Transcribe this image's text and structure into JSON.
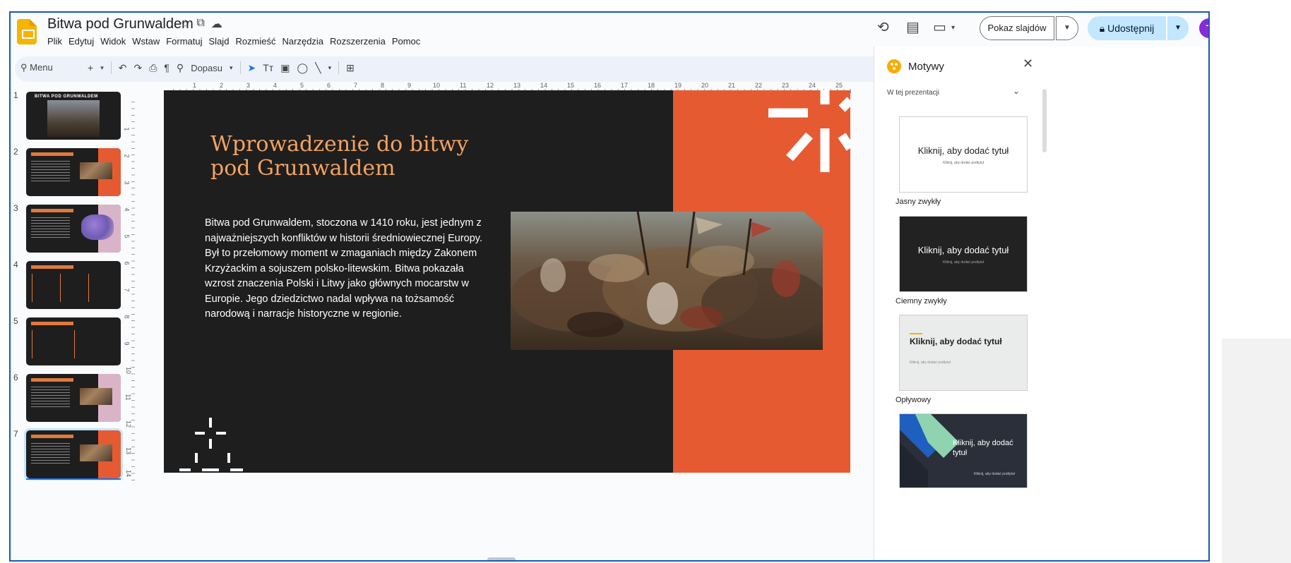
{
  "document": {
    "title": "Bitwa pod Grunwaldem",
    "menu": [
      "Plik",
      "Edytuj",
      "Widok",
      "Wstaw",
      "Formatuj",
      "Slajd",
      "Rozmieść",
      "Narzędzia",
      "Rozszerzenia",
      "Pomoc"
    ]
  },
  "header": {
    "present_label": "Pokaz slajdów",
    "share_label": "Udostępnij",
    "avatar_initial": "T"
  },
  "toolbar": {
    "search_label": "Menu",
    "zoom_label": "Dopasu"
  },
  "ruler": {
    "top": [
      "1",
      "2",
      "3",
      "4",
      "5",
      "6",
      "7",
      "8",
      "9",
      "10",
      "11",
      "12",
      "13",
      "14",
      "15",
      "16",
      "17",
      "18",
      "19",
      "20",
      "21",
      "22",
      "23",
      "24",
      "25"
    ],
    "left": [
      "1",
      "2",
      "3",
      "4",
      "5",
      "6",
      "7",
      "8",
      "9",
      "10",
      "11",
      "12",
      "13",
      "14"
    ]
  },
  "filmstrip": {
    "slides": [
      {
        "number": "1",
        "title": "BITWA POD GRUNWALDEM"
      },
      {
        "number": "2"
      },
      {
        "number": "3"
      },
      {
        "number": "4"
      },
      {
        "number": "5"
      },
      {
        "number": "6"
      },
      {
        "number": "7"
      }
    ]
  },
  "slide": {
    "title": "Wprowadzenie do bitwy pod Grunwaldem",
    "body": "Bitwa pod Grunwaldem, stoczona w 1410 roku, jest jednym z najważniejszych konfliktów w historii średniowiecznej Europy. Był to przełomowy moment w zmaganiach między Zakonem Krzyżackim a sojuszem polsko-litewskim. Bitwa pokazała wzrost znaczenia Polski i Litwy jako głównych mocarstw w Europie. Jego dziedzictwo nadal wpływa na tożsamość narodową i narracje historyczne w regionie.",
    "colors": {
      "background": "#1e1e1e",
      "accent": "#e65a32",
      "title": "#f4a261"
    }
  },
  "themes_panel": {
    "title": "Motywy",
    "section": "W tej prezentacji",
    "themes": [
      {
        "name": "Jasny zwykły",
        "title": "Kliknij, aby dodać tytuł",
        "subtitle": "Kliknij, aby dodać podtytuł"
      },
      {
        "name": "Ciemny zwykły",
        "title": "Kliknij, aby dodać tytuł",
        "subtitle": "Kliknij, aby dodać podtytuł"
      },
      {
        "name": "Opływowy",
        "title": "Kliknij, aby dodać tytuł",
        "subtitle": "Kliknij, aby dodać podtytuł"
      },
      {
        "title": "Kliknij, aby dodać tytuł",
        "subtitle": "Kliknij, aby dodać podtytuł"
      }
    ]
  }
}
